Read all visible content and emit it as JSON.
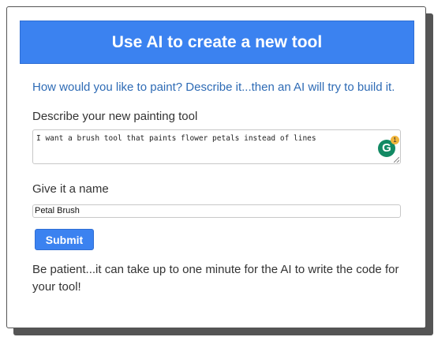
{
  "dialog": {
    "title": "Use AI to create a new tool",
    "intro": "How would you like to paint? Describe it...then an AI will try to build it.",
    "describe_label": "Describe your new painting tool",
    "describe_value": "I want a brush tool that paints flower petals instead of lines",
    "name_label": "Give it a name",
    "name_value": "Petal Brush",
    "submit_label": "Submit",
    "patience_text": "Be patient...it can take up to one minute for the AI to write the code for your tool!"
  },
  "grammarly": {
    "icon": "grammarly-icon",
    "letter": "G",
    "badge_count": "1"
  },
  "colors": {
    "accent": "#3b82f0",
    "intro_text": "#2e6bb5",
    "body_text": "#333333",
    "shadow": "#555555"
  }
}
